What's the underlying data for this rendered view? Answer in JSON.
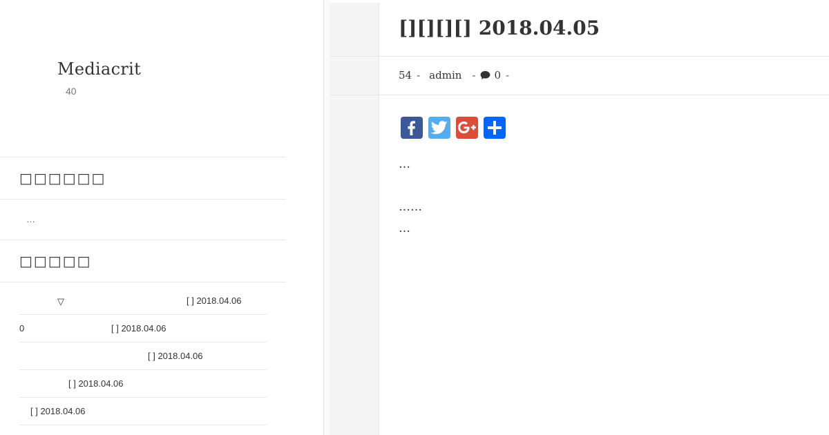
{
  "site": {
    "title": "Mediacrit",
    "description": "40"
  },
  "sidebar": {
    "widget1": {
      "title": "□□□□□□",
      "text": "…"
    },
    "widget2": {
      "title": "□□□□□",
      "items": [
        {
          "lead": "▽",
          "text": "[ ] 2018.04.06"
        },
        {
          "lead": "0",
          "text": "[ ] 2018.04.06"
        },
        {
          "lead": "",
          "text": "[ ] 2018.04.06"
        },
        {
          "lead": "",
          "text": "[ ] 2018.04.06"
        },
        {
          "lead": "",
          "text": "[ ] 2018.04.06"
        }
      ]
    }
  },
  "article": {
    "title": "[][][][] 2018.04.05",
    "meta": {
      "views": "54",
      "author": "admin",
      "comments": "0",
      "sep": "-"
    },
    "share": {
      "icons": [
        "facebook-icon",
        "twitter-icon",
        "google-plus-icon",
        "share-plus-icon"
      ]
    },
    "paragraphs": [
      "…",
      "……",
      "…"
    ]
  },
  "colors": {
    "facebook": "#3b5998",
    "twitter": "#55acee",
    "google_plus": "#dd4b39",
    "share": "#0166ff"
  }
}
